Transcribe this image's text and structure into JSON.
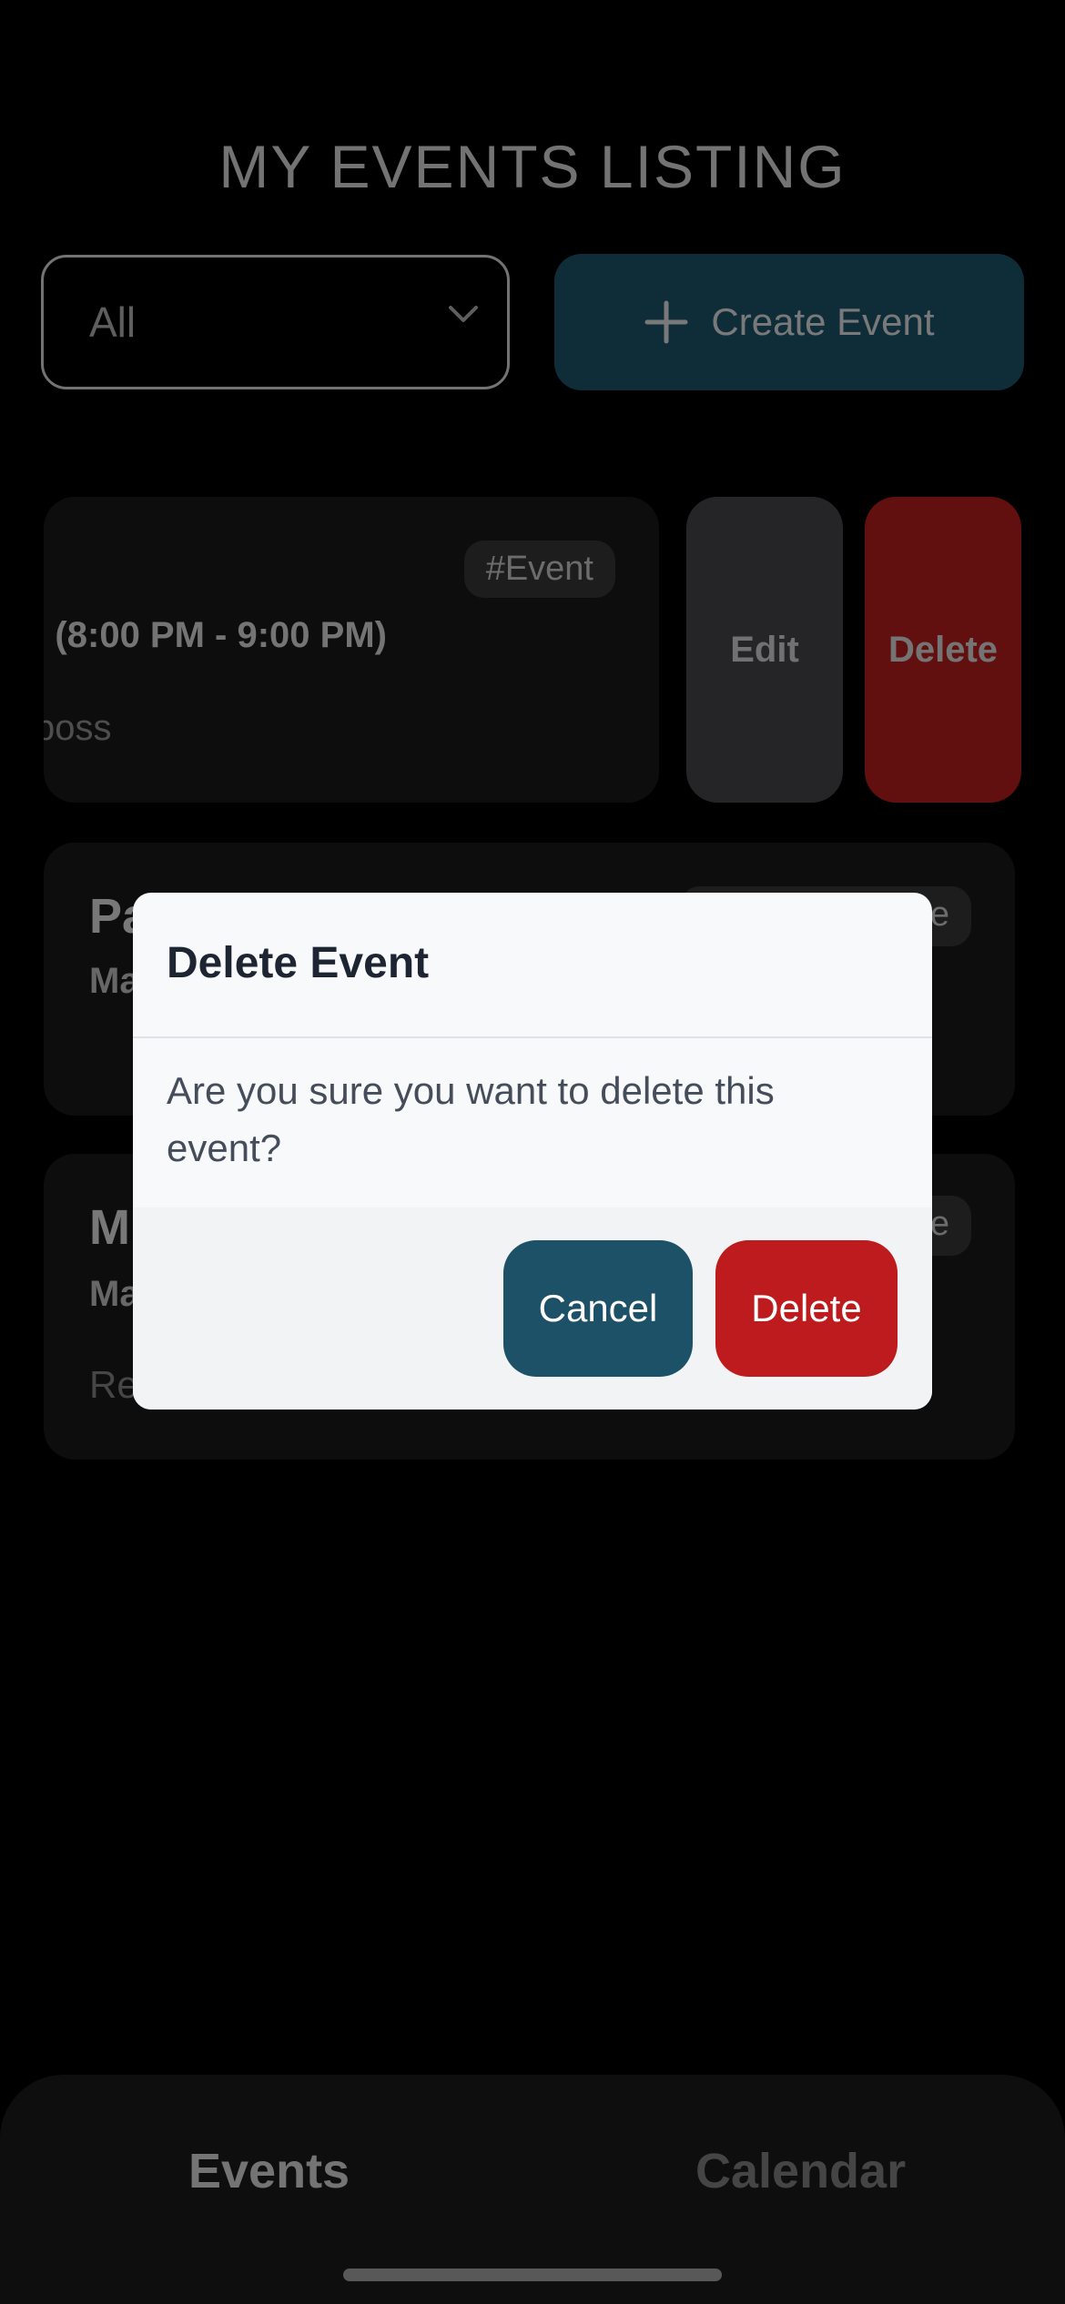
{
  "header": {
    "title": "MY EVENTS LISTING",
    "filter_value": "All",
    "create_label": "Create Event"
  },
  "events": [
    {
      "tag": "#Event",
      "time": ": (8:00 PM - 9:00 PM)",
      "host": "boss",
      "swipe_actions": {
        "edit": "Edit",
        "delete": "Delete"
      }
    },
    {
      "name": "Pa",
      "sub": "Ma",
      "tag": "e"
    },
    {
      "name": "M",
      "sub": "Ma",
      "desc": "Re",
      "tag": "e"
    }
  ],
  "dialog": {
    "title": "Delete Event",
    "message": "Are you sure you want to delete this event?",
    "cancel_label": "Cancel",
    "delete_label": "Delete"
  },
  "tabbar": {
    "events_label": "Events",
    "calendar_label": "Calendar"
  },
  "colors": {
    "accent": "#1f5a73",
    "danger": "#c21f1f",
    "background": "#000000"
  }
}
